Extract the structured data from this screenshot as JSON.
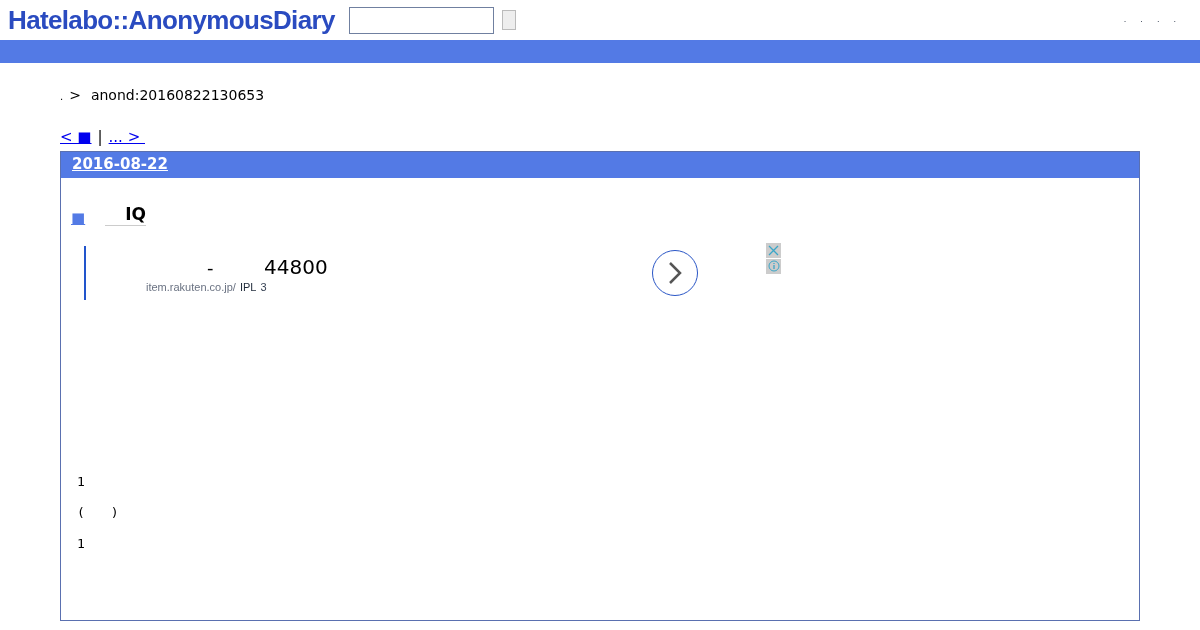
{
  "header": {
    "logo": "Hatelabo::AnonymousDiary",
    "nav": [
      ".",
      ".",
      ".",
      "."
    ]
  },
  "breadcrumb": {
    "home": ".",
    "separator": ">",
    "current": "anond:20160822130653"
  },
  "pager": {
    "prev": "< ■",
    "separator": "|",
    "next": "... > "
  },
  "day": {
    "date": "2016-08-22",
    "entry": {
      "marker": "■",
      "title": "IQ",
      "ad": {
        "dash": "-",
        "price": "44800",
        "url": "item.rakuten.co.jp/",
        "url_tail": "3",
        "overlay": "IPL"
      },
      "lines": [
        "1",
        "(　　)",
        "1"
      ]
    }
  }
}
